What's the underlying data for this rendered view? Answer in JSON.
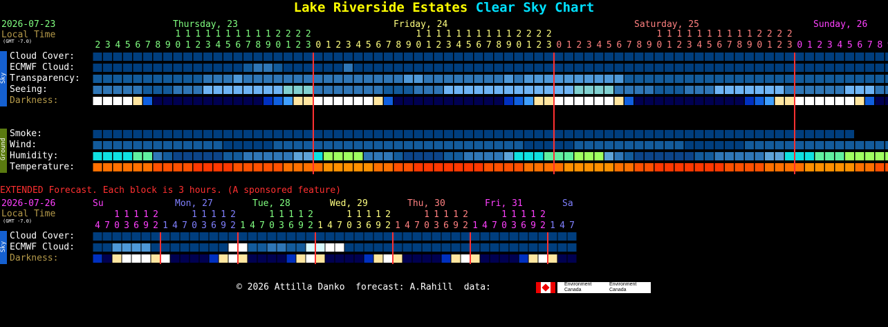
{
  "title": {
    "location": "Lake Riverside Estates",
    "suffix": "Clear Sky Chart"
  },
  "header": {
    "date": "2026-07-23",
    "local_time": "Local Time",
    "gmt": "(GMT -7.0)"
  },
  "days": [
    {
      "label": "Thursday, 23",
      "color": "#80ff80"
    },
    {
      "label": "Friday, 24",
      "color": "#ffff80"
    },
    {
      "label": "Saturday, 25",
      "color": "#ff8080"
    },
    {
      "label": "Sunday, 26",
      "color": "#ff40ff"
    }
  ],
  "rows": {
    "cloud": "Cloud Cover:",
    "ecmwf": "ECMWF Cloud:",
    "transparency": "Transparency:",
    "seeing": "Seeing:",
    "darkness": "Darkness:",
    "smoke": "Smoke:",
    "wind": "Wind:",
    "humidity": "Humidity:",
    "temperature": "Temperature:"
  },
  "side": {
    "sky": "Sky",
    "ground": "Ground"
  },
  "extended": {
    "note": "EXTENDED Forecast. Each block is 3 hours. (A sponsored feature)",
    "date": "2026-07-26",
    "local_time": "Local Time",
    "gmt": "(GMT -7.0)",
    "days": [
      {
        "label": "Su",
        "color": "#ff40ff"
      },
      {
        "label": "Mon, 27",
        "color": "#8080ff"
      },
      {
        "label": "Tue, 28",
        "color": "#80ff80"
      },
      {
        "label": "Wed, 29",
        "color": "#ffff80"
      },
      {
        "label": "Thu, 30",
        "color": "#ff8080"
      },
      {
        "label": "Fri, 31",
        "color": "#ff40ff"
      },
      {
        "label": "Sa",
        "color": "#8080ff"
      }
    ],
    "rows": {
      "cloud": "Cloud Cover:",
      "ecmwf": "ECMWF Cloud:",
      "darkness": "Darkness:"
    }
  },
  "footer": {
    "text": "© 2026 Attilla Danko  forecast: A.Rahill  data:",
    "logo_text": "Environment Canada"
  },
  "chart_data": {
    "type": "heatmap",
    "hours_start": 2,
    "hours_count": 84,
    "midnight_hour_indices": [
      22,
      46,
      70
    ],
    "cloud_cover": [
      0,
      0,
      0,
      0,
      0,
      0,
      0,
      0,
      0,
      0,
      0,
      0,
      0,
      0,
      0,
      0,
      0,
      0,
      0,
      0,
      0,
      0,
      0,
      0,
      0,
      0,
      0,
      0,
      0,
      0,
      0,
      0,
      0,
      0,
      0,
      0,
      0,
      0,
      0,
      0,
      0,
      0,
      0,
      0,
      0,
      0,
      0,
      0,
      0,
      0,
      0,
      0,
      0,
      0,
      0,
      0,
      0,
      0,
      0,
      0,
      0,
      0,
      0,
      0,
      0,
      0,
      0,
      0,
      0,
      0,
      0,
      0,
      0,
      0,
      0,
      0,
      0,
      0,
      0,
      0,
      0,
      0,
      0,
      0
    ],
    "ecmwf_cloud": [
      0,
      0,
      0,
      0,
      0,
      0,
      0,
      0,
      0,
      0,
      0,
      0,
      0,
      0,
      0,
      1,
      2,
      2,
      1,
      0,
      0,
      0,
      0,
      0,
      0,
      2,
      0,
      0,
      0,
      0,
      0,
      0,
      0,
      0,
      0,
      0,
      0,
      0,
      0,
      0,
      0,
      0,
      0,
      0,
      0,
      0,
      0,
      0,
      0,
      0,
      0,
      0,
      0,
      0,
      0,
      0,
      0,
      0,
      0,
      0,
      0,
      0,
      0,
      0,
      0,
      0,
      0,
      0,
      0,
      0,
      0,
      0,
      0,
      0,
      0,
      0,
      0,
      0,
      0,
      0,
      0,
      0,
      0,
      0
    ],
    "transparency": [
      1,
      1,
      1,
      1,
      1,
      1,
      1,
      1,
      1,
      1,
      1,
      2,
      2,
      2,
      3,
      2,
      2,
      2,
      2,
      2,
      2,
      2,
      2,
      2,
      2,
      2,
      2,
      2,
      2,
      2,
      2,
      3,
      3,
      2,
      2,
      2,
      2,
      2,
      2,
      2,
      2,
      3,
      2,
      3,
      3,
      3,
      3,
      3,
      3,
      3,
      3,
      3,
      3,
      1,
      1,
      1,
      1,
      1,
      1,
      1,
      1,
      1,
      1,
      1,
      1,
      1,
      1,
      1,
      1,
      1,
      1,
      1,
      1,
      1,
      1,
      1,
      1,
      1,
      1,
      1,
      1,
      1,
      1,
      1
    ],
    "seeing": [
      2,
      2,
      2,
      2,
      2,
      1,
      1,
      1,
      2,
      2,
      2,
      3,
      3,
      3,
      3,
      3,
      3,
      3,
      3,
      4,
      4,
      4,
      2,
      2,
      2,
      2,
      2,
      2,
      2,
      1,
      1,
      1,
      2,
      2,
      2,
      3,
      3,
      3,
      3,
      3,
      3,
      3,
      3,
      3,
      3,
      3,
      3,
      3,
      4,
      4,
      4,
      4,
      2,
      2,
      2,
      2,
      1,
      1,
      1,
      2,
      2,
      2,
      3,
      3,
      3,
      3,
      3,
      3,
      3,
      2,
      2,
      2,
      2,
      2,
      2,
      3,
      3,
      3,
      2,
      2,
      2,
      2,
      3,
      3
    ],
    "darkness": [
      0,
      0,
      0,
      0,
      1,
      4,
      6,
      6,
      6,
      6,
      6,
      6,
      6,
      6,
      6,
      6,
      6,
      5,
      4,
      3,
      1,
      1,
      0,
      0,
      0,
      0,
      0,
      0,
      1,
      4,
      6,
      6,
      6,
      6,
      6,
      6,
      6,
      6,
      6,
      6,
      6,
      5,
      4,
      3,
      1,
      1,
      0,
      0,
      0,
      0,
      0,
      0,
      1,
      4,
      6,
      6,
      6,
      6,
      6,
      6,
      6,
      6,
      6,
      6,
      6,
      5,
      4,
      3,
      1,
      1,
      0,
      0,
      0,
      0,
      0,
      0,
      1,
      4,
      6,
      6,
      6,
      6,
      6,
      6
    ],
    "smoke": [
      0,
      0,
      0,
      0,
      0,
      0,
      0,
      0,
      0,
      0,
      0,
      0,
      0,
      0,
      0,
      0,
      0,
      0,
      0,
      0,
      0,
      0,
      0,
      0,
      0,
      0,
      0,
      0,
      0,
      0,
      0,
      0,
      0,
      0,
      0,
      0,
      0,
      0,
      0,
      0,
      0,
      0,
      0,
      0,
      0,
      0,
      0,
      0,
      0,
      0,
      0,
      0,
      0,
      0,
      0,
      0,
      0,
      0,
      0,
      0,
      0,
      0,
      0,
      0,
      0,
      0,
      0,
      0,
      0,
      0,
      0,
      0,
      0,
      0,
      0,
      0,
      -1,
      -1,
      -1,
      -1,
      -1,
      -1,
      -1,
      -1
    ],
    "wind": [
      1,
      1,
      1,
      1,
      1,
      1,
      1,
      1,
      1,
      1,
      1,
      1,
      1,
      0,
      0,
      0,
      0,
      0,
      1,
      1,
      1,
      1,
      1,
      1,
      1,
      1,
      1,
      1,
      1,
      1,
      1,
      1,
      1,
      1,
      1,
      1,
      1,
      1,
      1,
      1,
      1,
      1,
      1,
      0,
      0,
      0,
      0,
      0,
      1,
      1,
      1,
      1,
      1,
      1,
      1,
      1,
      1,
      1,
      1,
      0,
      0,
      0,
      0,
      0,
      0,
      1,
      1,
      1,
      1,
      1,
      1,
      1,
      1,
      1,
      1,
      1,
      1,
      1,
      1,
      1,
      1,
      1,
      1,
      1
    ],
    "humidity": [
      5,
      5,
      5,
      5,
      6,
      6,
      3,
      2,
      1,
      1,
      1,
      1,
      1,
      2,
      2,
      3,
      3,
      3,
      3,
      3,
      4,
      4,
      5,
      7,
      7,
      7,
      7,
      3,
      3,
      3,
      2,
      1,
      1,
      1,
      1,
      2,
      2,
      3,
      3,
      3,
      3,
      4,
      5,
      5,
      5,
      6,
      6,
      6,
      7,
      7,
      7,
      4,
      3,
      2,
      1,
      1,
      1,
      1,
      1,
      1,
      2,
      2,
      3,
      3,
      3,
      3,
      3,
      4,
      4,
      5,
      5,
      5,
      6,
      6,
      6,
      7,
      7,
      7,
      7,
      7,
      7,
      3,
      3,
      2
    ],
    "temperature": [
      9,
      9,
      9,
      9,
      9,
      9,
      8,
      8,
      8,
      8,
      7,
      7,
      7,
      7,
      8,
      8,
      8,
      8,
      8,
      9,
      9,
      9,
      9,
      10,
      10,
      10,
      10,
      10,
      9,
      9,
      8,
      8,
      7,
      7,
      7,
      7,
      7,
      7,
      7,
      8,
      8,
      8,
      8,
      9,
      9,
      9,
      9,
      10,
      10,
      10,
      10,
      10,
      9,
      9,
      8,
      8,
      7,
      7,
      7,
      7,
      7,
      7,
      7,
      8,
      8,
      8,
      8,
      9,
      9,
      9,
      9,
      10,
      10,
      10,
      10,
      10,
      9,
      9,
      8,
      8,
      8,
      7,
      7,
      7
    ],
    "extended": {
      "block_hours": 3,
      "hours_start": 4,
      "blocks_count": 50,
      "midnight_block_indices": [
        7,
        15,
        23,
        31,
        39,
        47
      ],
      "cloud_cover": [
        0,
        0,
        0,
        0,
        0,
        0,
        0,
        0,
        0,
        0,
        0,
        0,
        0,
        0,
        0,
        0,
        0,
        0,
        0,
        0,
        0,
        0,
        0,
        0,
        0,
        0,
        0,
        0,
        0,
        0,
        0,
        0,
        0,
        0,
        0,
        0,
        0,
        0,
        0,
        0,
        0,
        0,
        0,
        0,
        0,
        0,
        0,
        0,
        0,
        0
      ],
      "ecmwf_cloud": [
        0,
        0,
        3,
        3,
        3,
        3,
        0,
        0,
        0,
        0,
        0,
        0,
        0,
        0,
        9,
        9,
        1,
        1,
        2,
        2,
        1,
        1,
        8,
        8,
        9,
        9,
        0,
        0,
        0,
        0,
        0,
        0,
        0,
        0,
        0,
        0,
        0,
        0,
        0,
        0,
        0,
        0,
        0,
        0,
        0,
        0,
        0,
        0,
        0,
        0
      ],
      "darkness": [
        5,
        6,
        1,
        0,
        0,
        0,
        1,
        0,
        6,
        6,
        6,
        6,
        5,
        1,
        0,
        1,
        6,
        6,
        6,
        6,
        5,
        1,
        0,
        1,
        6,
        6,
        6,
        6,
        5,
        1,
        0,
        1,
        6,
        6,
        6,
        6,
        5,
        1,
        0,
        1,
        6,
        6,
        6,
        6,
        5,
        1,
        0,
        1,
        6,
        6
      ]
    },
    "colors": {
      "cloud": [
        "#003e7e",
        "#135b9b",
        "#2f76b6",
        "#4e98d8",
        "#6eb4f4",
        "#8dd1ff",
        "#a6e2ff",
        "#c0efff",
        "#d8f9ff",
        "#ffffff"
      ],
      "transparency": [
        "#003e7e",
        "#135b9b",
        "#2f76b6",
        "#4e98d8",
        "#6eb4f4"
      ],
      "seeing": [
        "#003e7e",
        "#135b9b",
        "#2f76b6",
        "#6eb4f4",
        "#80d0d0"
      ],
      "darkness": [
        "#ffffff",
        "#ffe6a0",
        "#f0c060",
        "#40a0ff",
        "#1060e0",
        "#0030c0",
        "#000050"
      ],
      "humidity": [
        "#08306b",
        "#0c4488",
        "#135b9b",
        "#2f76b6",
        "#5ea3d8",
        "#10e0e0",
        "#60f0a0",
        "#a0ff60"
      ],
      "wind": [
        "#003e7e",
        "#135b9b"
      ],
      "smoke": [
        "#003e7e"
      ],
      "temperature": [
        "#a00000",
        "#b00000",
        "#c00000",
        "#d00000",
        "#e00000",
        "#f01000",
        "#ff2000",
        "#ff3800",
        "#ff5000",
        "#ff7000",
        "#ff9000"
      ],
      "midnight_line": "#ff3030"
    }
  }
}
